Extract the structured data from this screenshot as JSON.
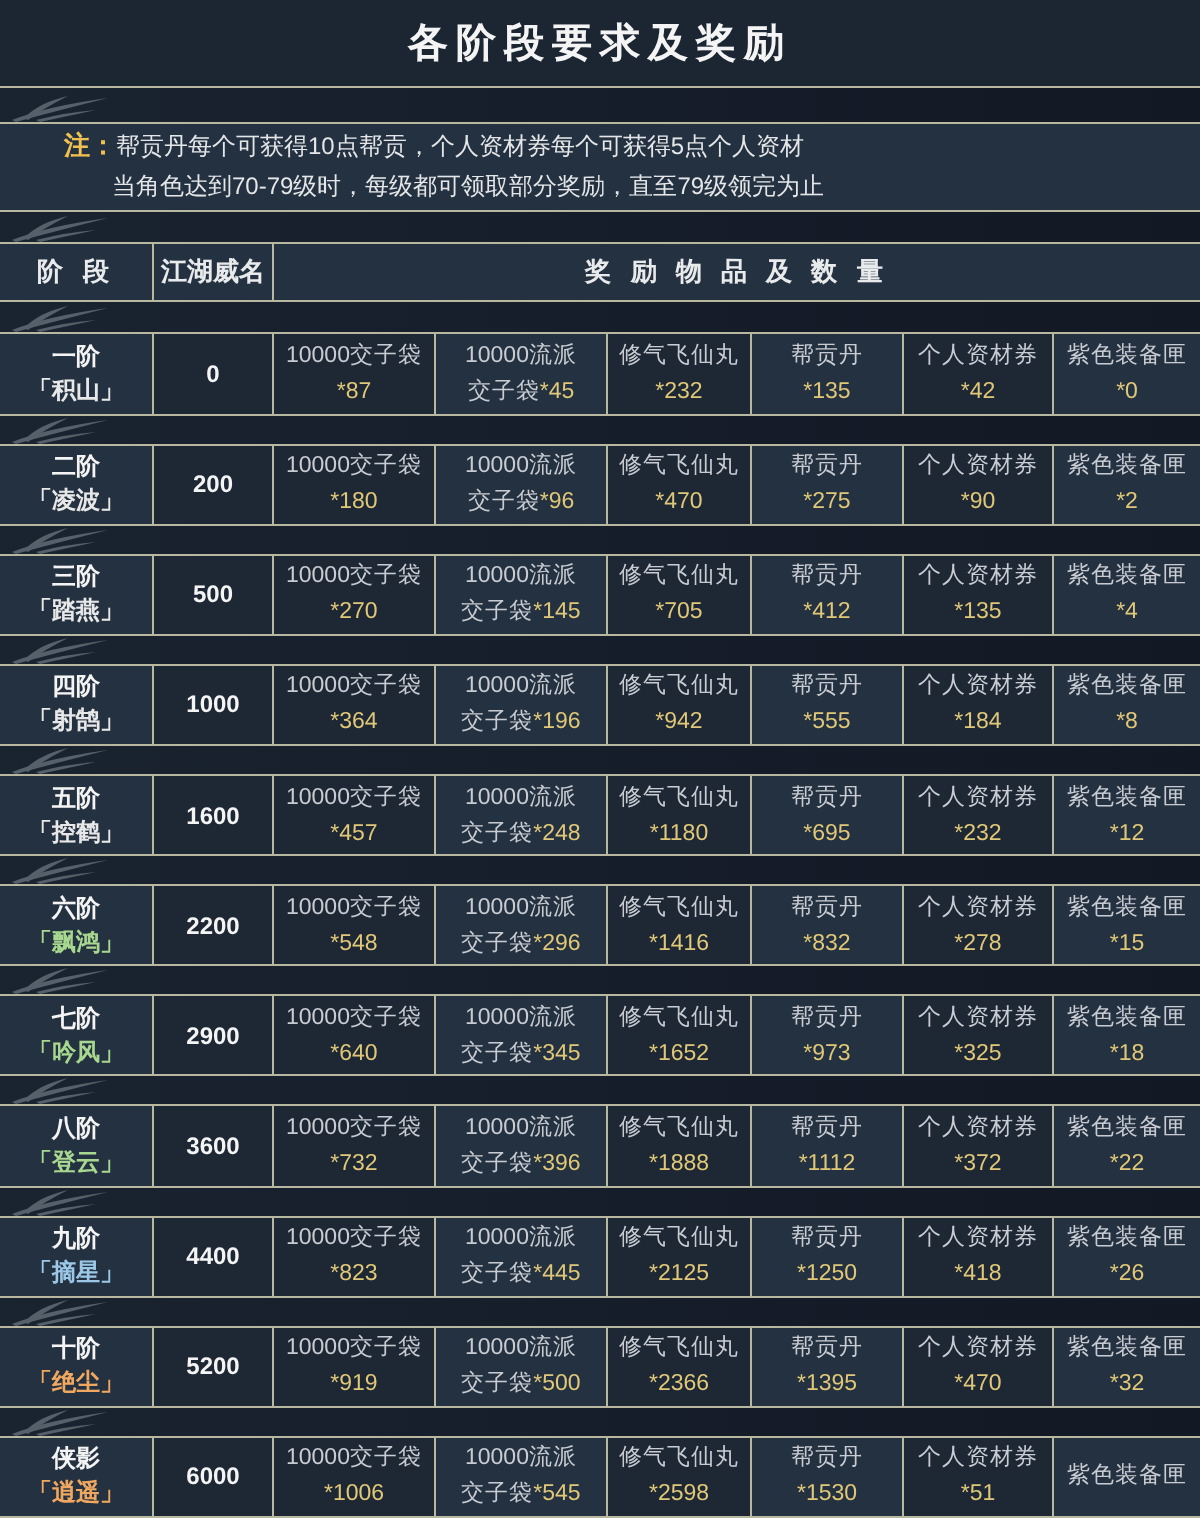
{
  "title": "各阶段要求及奖励",
  "note": {
    "label": "注：",
    "lines": [
      "帮贡丹每个可获得10点帮贡，个人资材券每个可获得5点个人资材",
      "当角色达到70-79级时，每级都可领取部分奖励，直至79级领完为止"
    ]
  },
  "columns": [
    "阶 段",
    "江湖威名",
    "奖 励 物 品 及 数 量"
  ],
  "rows": [
    {
      "stage": "一阶",
      "name": "「积山」",
      "color": "#e8e8e8",
      "fame": "0",
      "rewards": [
        {
          "name": "10000交子袋",
          "qty": "*87"
        },
        {
          "name": "10000流派",
          "suffix": "交子袋",
          "qty": "*45"
        },
        {
          "name": "修气飞仙丸",
          "qty": "*232"
        },
        {
          "name": "帮贡丹",
          "qty": "*135"
        },
        {
          "name": "个人资材券",
          "qty": "*42"
        },
        {
          "name": "紫色装备匣",
          "qty": "*0"
        }
      ]
    },
    {
      "stage": "二阶",
      "name": "「凌波」",
      "color": "#e8e8e8",
      "fame": "200",
      "rewards": [
        {
          "name": "10000交子袋",
          "qty": "*180"
        },
        {
          "name": "10000流派",
          "suffix": "交子袋",
          "qty": "*96"
        },
        {
          "name": "修气飞仙丸",
          "qty": "*470"
        },
        {
          "name": "帮贡丹",
          "qty": "*275"
        },
        {
          "name": "个人资材券",
          "qty": "*90"
        },
        {
          "name": "紫色装备匣",
          "qty": "*2"
        }
      ]
    },
    {
      "stage": "三阶",
      "name": "「踏燕」",
      "color": "#e8e8e8",
      "fame": "500",
      "rewards": [
        {
          "name": "10000交子袋",
          "qty": "*270"
        },
        {
          "name": "10000流派",
          "suffix": "交子袋",
          "qty": "*145"
        },
        {
          "name": "修气飞仙丸",
          "qty": "*705"
        },
        {
          "name": "帮贡丹",
          "qty": "*412"
        },
        {
          "name": "个人资材券",
          "qty": "*135"
        },
        {
          "name": "紫色装备匣",
          "qty": "*4"
        }
      ]
    },
    {
      "stage": "四阶",
      "name": "「射鹄」",
      "color": "#e8e8e8",
      "fame": "1000",
      "rewards": [
        {
          "name": "10000交子袋",
          "qty": "*364"
        },
        {
          "name": "10000流派",
          "suffix": "交子袋",
          "qty": "*196"
        },
        {
          "name": "修气飞仙丸",
          "qty": "*942"
        },
        {
          "name": "帮贡丹",
          "qty": "*555"
        },
        {
          "name": "个人资材券",
          "qty": "*184"
        },
        {
          "name": "紫色装备匣",
          "qty": "*8"
        }
      ]
    },
    {
      "stage": "五阶",
      "name": "「控鹤」",
      "color": "#e8e8e8",
      "fame": "1600",
      "rewards": [
        {
          "name": "10000交子袋",
          "qty": "*457"
        },
        {
          "name": "10000流派",
          "suffix": "交子袋",
          "qty": "*248"
        },
        {
          "name": "修气飞仙丸",
          "qty": "*1180"
        },
        {
          "name": "帮贡丹",
          "qty": "*695"
        },
        {
          "name": "个人资材券",
          "qty": "*232"
        },
        {
          "name": "紫色装备匣",
          "qty": "*12"
        }
      ]
    },
    {
      "stage": "六阶",
      "name": "「飘鸿」",
      "color": "#a8d890",
      "fame": "2200",
      "rewards": [
        {
          "name": "10000交子袋",
          "qty": "*548"
        },
        {
          "name": "10000流派",
          "suffix": "交子袋",
          "qty": "*296"
        },
        {
          "name": "修气飞仙丸",
          "qty": "*1416"
        },
        {
          "name": "帮贡丹",
          "qty": "*832"
        },
        {
          "name": "个人资材券",
          "qty": "*278"
        },
        {
          "name": "紫色装备匣",
          "qty": "*15"
        }
      ]
    },
    {
      "stage": "七阶",
      "name": "「吟风」",
      "color": "#a8d890",
      "fame": "2900",
      "rewards": [
        {
          "name": "10000交子袋",
          "qty": "*640"
        },
        {
          "name": "10000流派",
          "suffix": "交子袋",
          "qty": "*345"
        },
        {
          "name": "修气飞仙丸",
          "qty": "*1652"
        },
        {
          "name": "帮贡丹",
          "qty": "*973"
        },
        {
          "name": "个人资材券",
          "qty": "*325"
        },
        {
          "name": "紫色装备匣",
          "qty": "*18"
        }
      ]
    },
    {
      "stage": "八阶",
      "name": "「登云」",
      "color": "#a8d890",
      "fame": "3600",
      "rewards": [
        {
          "name": "10000交子袋",
          "qty": "*732"
        },
        {
          "name": "10000流派",
          "suffix": "交子袋",
          "qty": "*396"
        },
        {
          "name": "修气飞仙丸",
          "qty": "*1888"
        },
        {
          "name": "帮贡丹",
          "qty": "*1112"
        },
        {
          "name": "个人资材券",
          "qty": "*372"
        },
        {
          "name": "紫色装备匣",
          "qty": "*22"
        }
      ]
    },
    {
      "stage": "九阶",
      "name": "「摘星」",
      "color": "#9cc8e8",
      "fame": "4400",
      "rewards": [
        {
          "name": "10000交子袋",
          "qty": "*823"
        },
        {
          "name": "10000流派",
          "suffix": "交子袋",
          "qty": "*445"
        },
        {
          "name": "修气飞仙丸",
          "qty": "*2125"
        },
        {
          "name": "帮贡丹",
          "qty": "*1250"
        },
        {
          "name": "个人资材券",
          "qty": "*418"
        },
        {
          "name": "紫色装备匣",
          "qty": "*26"
        }
      ]
    },
    {
      "stage": "十阶",
      "name": "「绝尘」",
      "color": "#f0a860",
      "fame": "5200",
      "rewards": [
        {
          "name": "10000交子袋",
          "qty": "*919"
        },
        {
          "name": "10000流派",
          "suffix": "交子袋",
          "qty": "*500"
        },
        {
          "name": "修气飞仙丸",
          "qty": "*2366"
        },
        {
          "name": "帮贡丹",
          "qty": "*1395"
        },
        {
          "name": "个人资材券",
          "qty": "*470"
        },
        {
          "name": "紫色装备匣",
          "qty": "*32"
        }
      ]
    },
    {
      "stage": "侠影",
      "name": "「逍遥」",
      "color": "#f0a860",
      "fame": "6000",
      "rewards": [
        {
          "name": "10000交子袋",
          "qty": "*1006"
        },
        {
          "name": "10000流派",
          "suffix": "交子袋",
          "qty": "*545"
        },
        {
          "name": "修气飞仙丸",
          "qty": "*2598"
        },
        {
          "name": "帮贡丹",
          "qty": "*1530"
        },
        {
          "name": "个人资材券",
          "qty": "*51"
        },
        {
          "name": "紫色装备匣"
        }
      ]
    }
  ]
}
